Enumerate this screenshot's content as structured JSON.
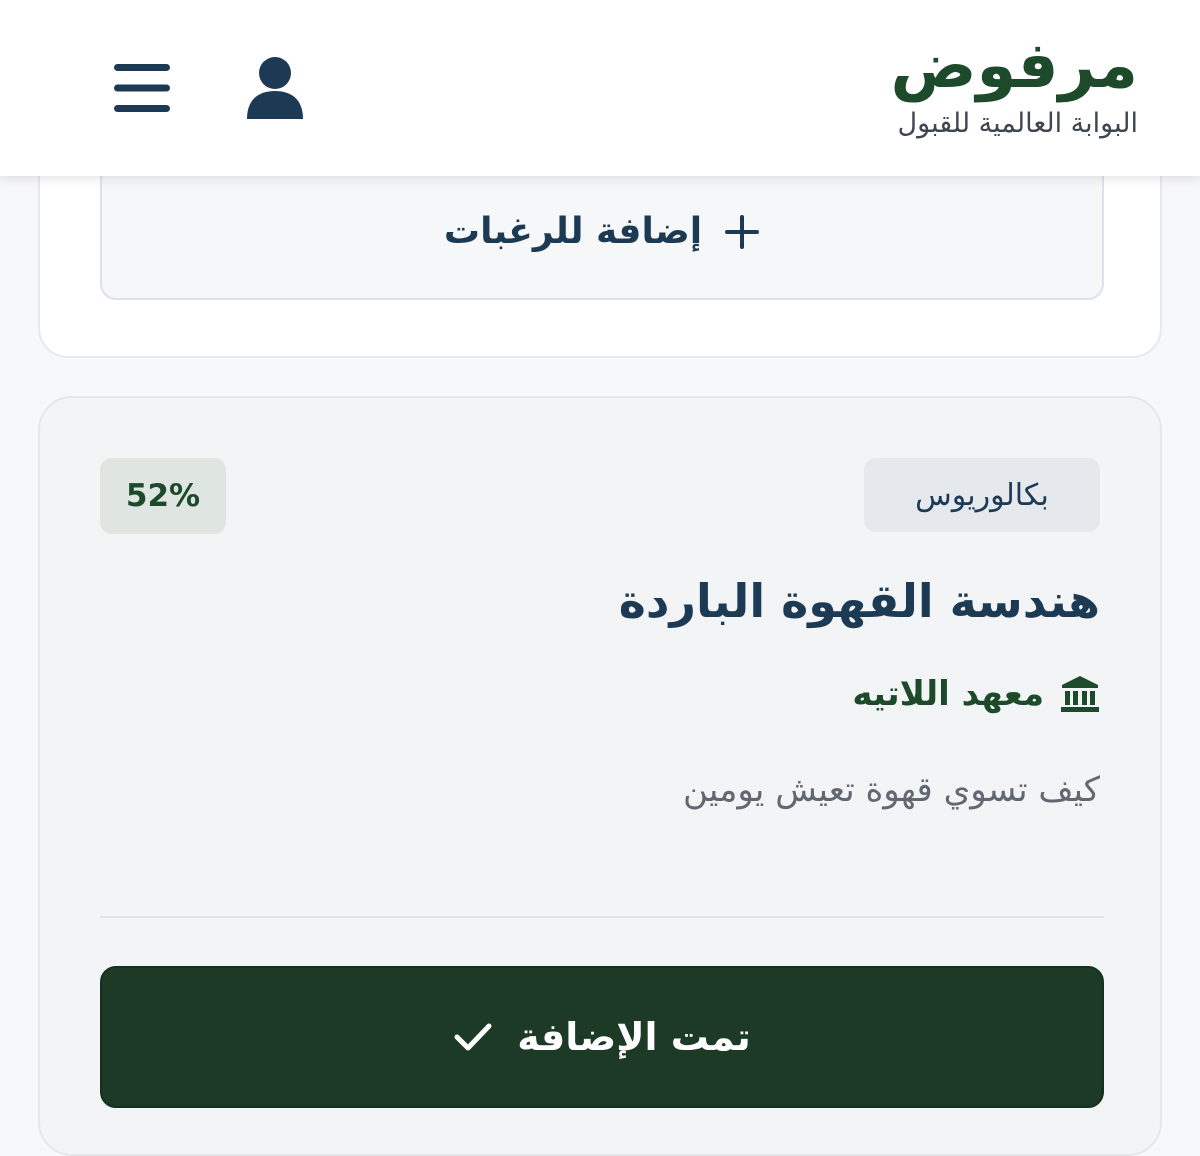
{
  "header": {
    "brand_title": "مرفوض",
    "brand_subtitle": "البوابة العالمية للقبول",
    "menu_icon": "hamburger-menu-icon",
    "user_icon": "user-profile-icon"
  },
  "wishlist": {
    "add_label": "إضافة للرغبات",
    "add_icon": "plus-icon"
  },
  "program": {
    "degree": "بكالوريوس",
    "match_percent": "52%",
    "title": "هندسة القهوة الباردة",
    "institution_icon": "institution-building-icon",
    "institution": "معهد اللاتيه",
    "description": "كيف تسوي قهوة تعيش يومين",
    "added_label": "تمت الإضافة",
    "added_icon": "checkmark-icon"
  },
  "colors": {
    "brand_green": "#1d4a2a",
    "navy_text": "#1d3a55",
    "button_dark_green": "#1c3a26"
  }
}
